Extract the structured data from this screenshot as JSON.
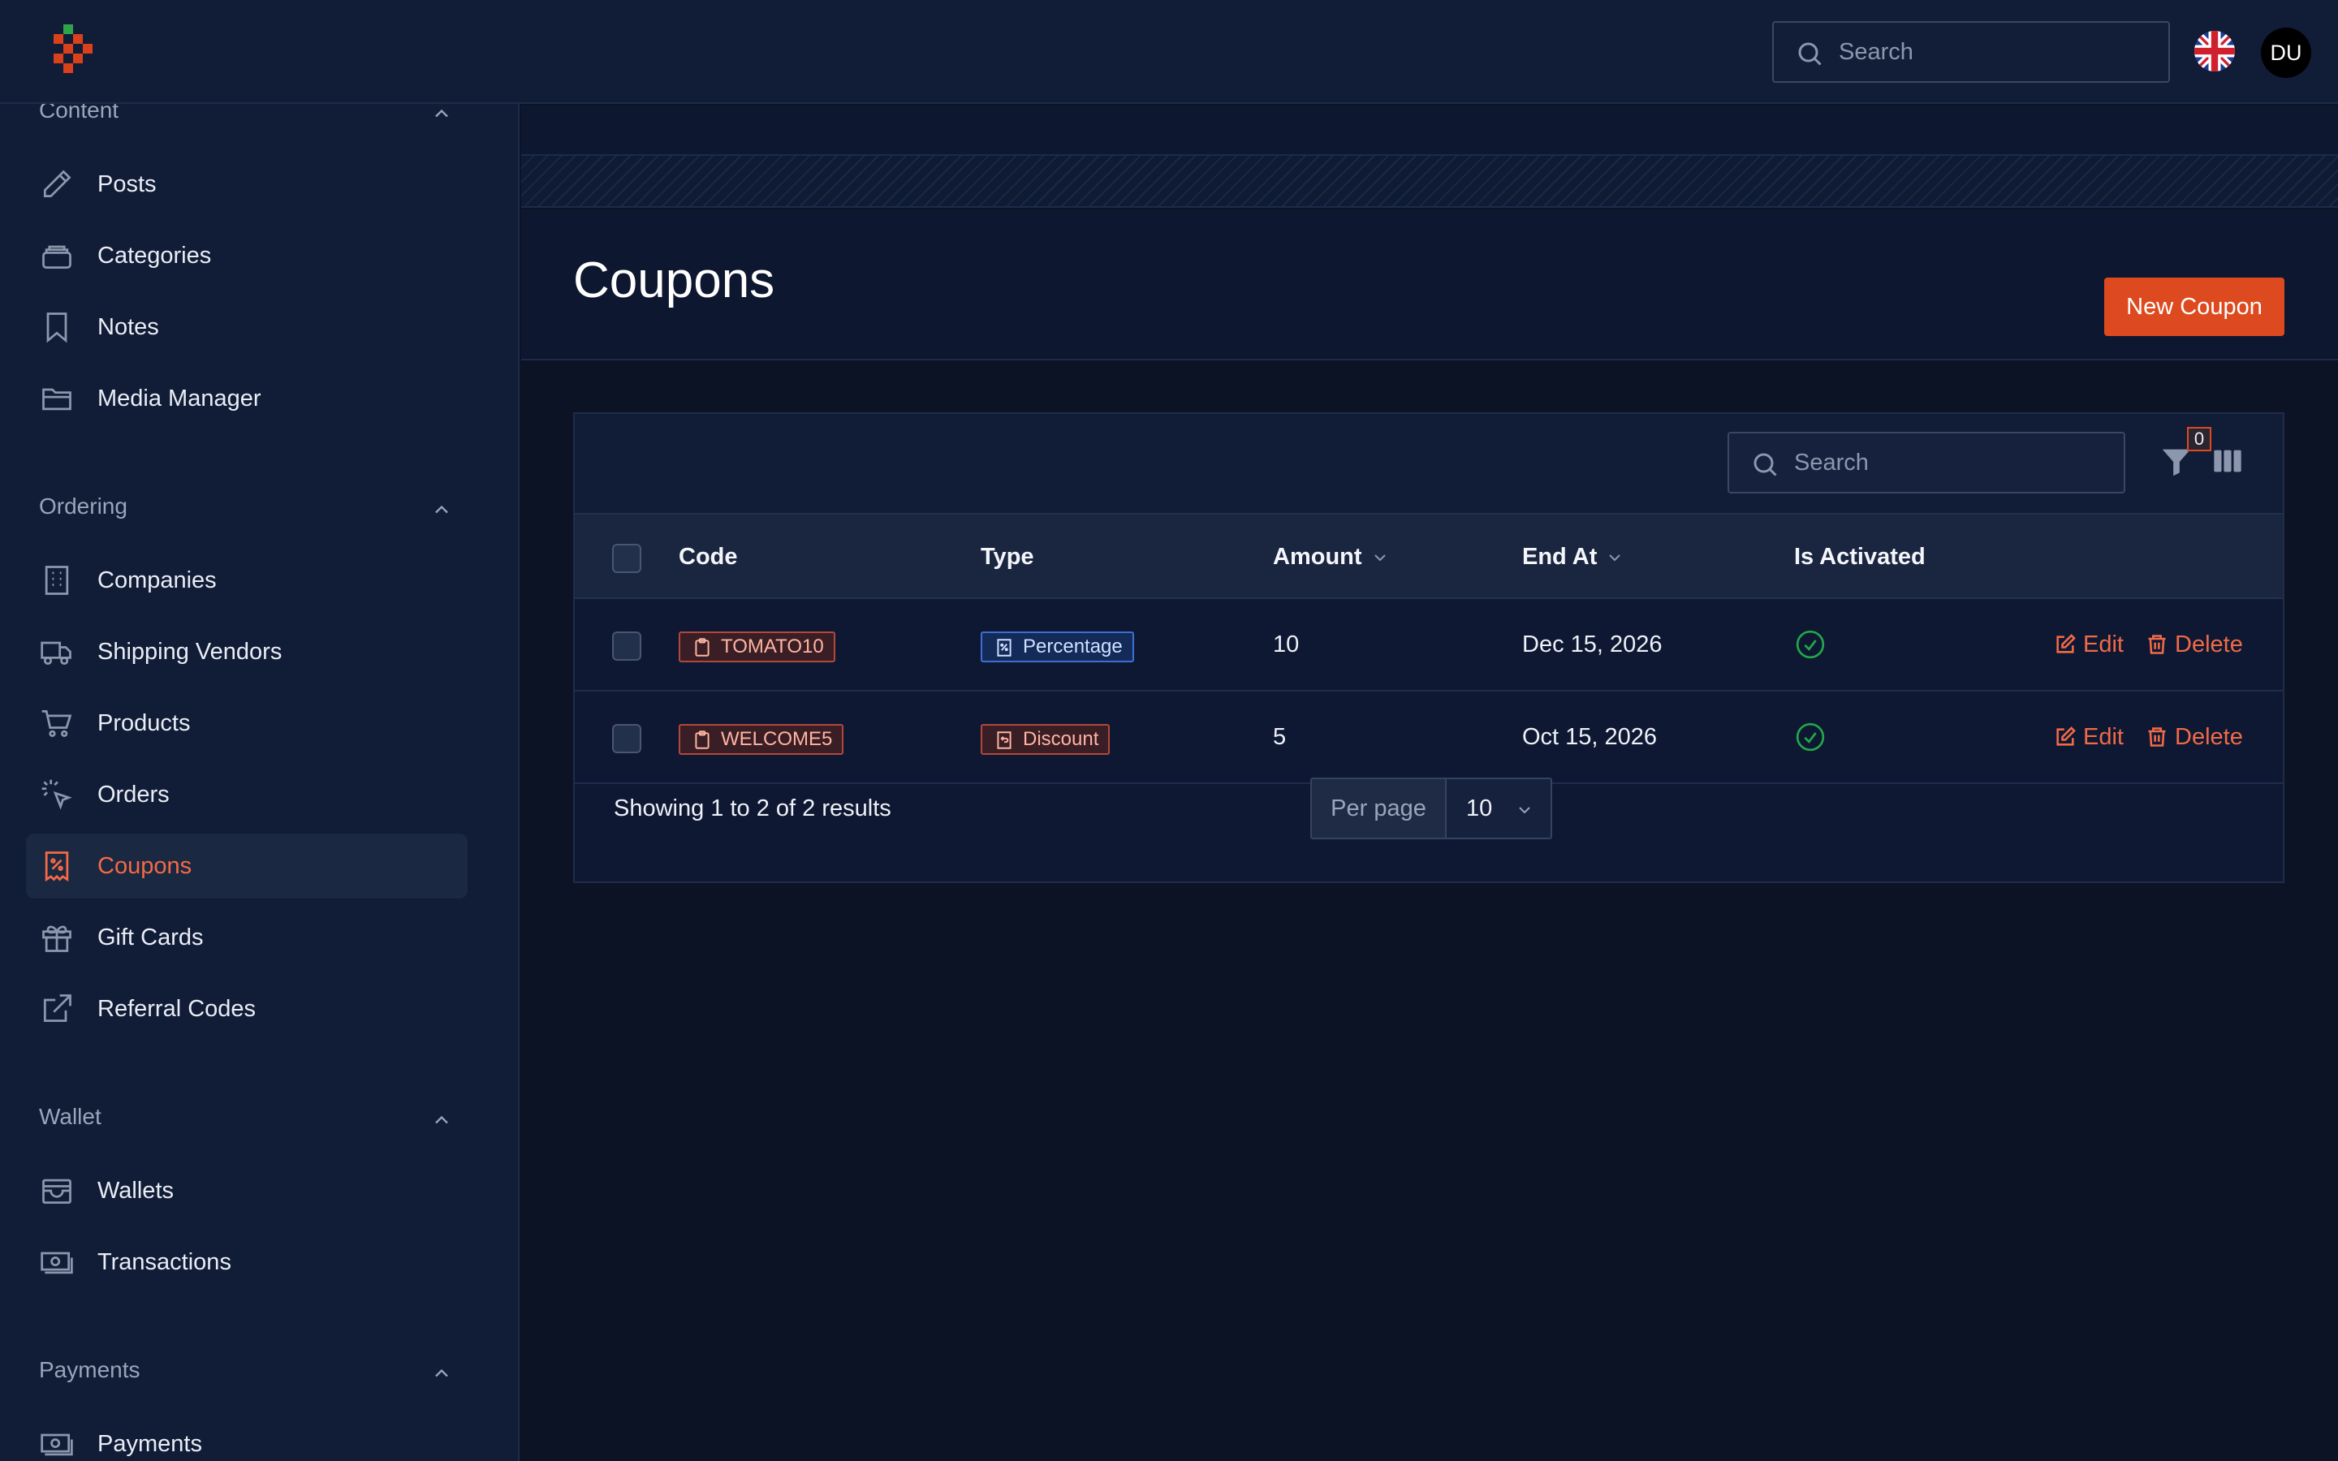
{
  "topbar": {
    "search_placeholder": "Search",
    "avatar_initials": "DU",
    "language": "English (UK)"
  },
  "sidebar": {
    "groups": [
      {
        "label": "Content",
        "items": [
          {
            "label": "Posts",
            "icon": "pencil-icon"
          },
          {
            "label": "Categories",
            "icon": "stack-icon"
          },
          {
            "label": "Notes",
            "icon": "bookmark-icon"
          },
          {
            "label": "Media Manager",
            "icon": "folder-icon"
          }
        ]
      },
      {
        "label": "Ordering",
        "items": [
          {
            "label": "Companies",
            "icon": "building-icon"
          },
          {
            "label": "Shipping Vendors",
            "icon": "truck-icon"
          },
          {
            "label": "Products",
            "icon": "cart-icon"
          },
          {
            "label": "Orders",
            "icon": "cursor-click-icon"
          },
          {
            "label": "Coupons",
            "icon": "receipt-percent-icon",
            "active": true
          },
          {
            "label": "Gift Cards",
            "icon": "gift-icon"
          },
          {
            "label": "Referral Codes",
            "icon": "external-link-icon"
          }
        ]
      },
      {
        "label": "Wallet",
        "items": [
          {
            "label": "Wallets",
            "icon": "wallet-icon"
          },
          {
            "label": "Transactions",
            "icon": "banknotes-icon"
          }
        ]
      },
      {
        "label": "Payments",
        "items": [
          {
            "label": "Payments",
            "icon": "banknotes-icon"
          }
        ]
      }
    ]
  },
  "page": {
    "title": "Coupons",
    "new_button": "New Coupon"
  },
  "table": {
    "search_placeholder": "Search",
    "filter_count": "0",
    "columns": {
      "code": "Code",
      "type": "Type",
      "amount": "Amount",
      "end_at": "End At",
      "is_activated": "Is Activated"
    },
    "rows": [
      {
        "code": "TOMATO10",
        "type": "Percentage",
        "amount": "10",
        "end_at": "Dec 15, 2026",
        "activated": true,
        "edit": "Edit",
        "delete": "Delete"
      },
      {
        "code": "WELCOME5",
        "type": "Discount",
        "amount": "5",
        "end_at": "Oct 15, 2026",
        "activated": true,
        "edit": "Edit",
        "delete": "Delete"
      }
    ],
    "footer_text": "Showing 1 to 2 of 2 results",
    "per_page_label": "Per page",
    "per_page_value": "10"
  },
  "colors": {
    "accent": "#de4a1f",
    "success": "#22a84a",
    "background": "#0b1325"
  }
}
